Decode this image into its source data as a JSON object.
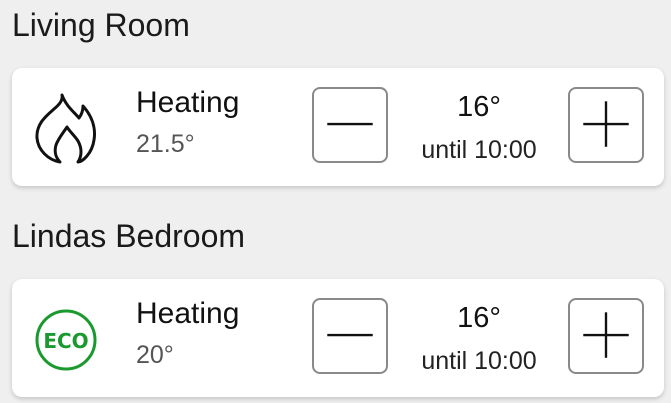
{
  "rooms": [
    {
      "name": "Living Room",
      "mode_icon": "flame-icon",
      "mode": "Heating",
      "current_temp": "21.5°",
      "target_temp": "16°",
      "until": "until 10:00"
    },
    {
      "name": "Lindas Bedroom",
      "mode_icon": "eco-icon",
      "eco_label": "ECO",
      "mode": "Heating",
      "current_temp": "20°",
      "target_temp": "16°",
      "until": "until 10:00"
    }
  ],
  "colors": {
    "background": "#efefef",
    "card": "#ffffff",
    "eco_green": "#1a9a2e",
    "button_border": "#8a8a8a"
  }
}
